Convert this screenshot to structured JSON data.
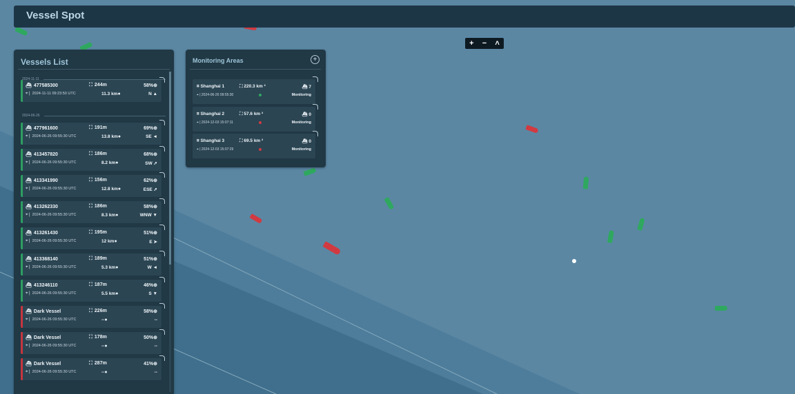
{
  "app": {
    "title": "Vessel Spot"
  },
  "zoom_controls": {
    "zoom_in": "+",
    "zoom_out": "−",
    "compass": "˄"
  },
  "colors": {
    "ok_status": "#2e9e62",
    "dark_status": "#c6363f",
    "panel_bg": "#213845",
    "sea": "#5b87a3"
  },
  "vessels_panel": {
    "title": "Vessels List",
    "date_groups": [
      "2024-11-11",
      "2024-06-26"
    ],
    "items": [
      {
        "id": "477585300",
        "length": "244m",
        "confidence": "58%",
        "time": "2024-11-11 09:23:50 UTC",
        "distance": "11.3 km",
        "direction": "N ▲",
        "status": "ok"
      },
      {
        "id": "477961600",
        "length": "191m",
        "confidence": "69%",
        "time": "2024-06-26 09:55:30 UTC",
        "distance": "13.8 km",
        "direction": "SE ◄",
        "status": "ok"
      },
      {
        "id": "413457820",
        "length": "186m",
        "confidence": "68%",
        "time": "2024-06-26 09:55:30 UTC",
        "distance": "8.2 km",
        "direction": "SW ➚",
        "status": "ok"
      },
      {
        "id": "413341990",
        "length": "156m",
        "confidence": "62%",
        "time": "2024-06-26 09:55:30 UTC",
        "distance": "12.8 km",
        "direction": "ESE ➚",
        "status": "ok"
      },
      {
        "id": "413262330",
        "length": "186m",
        "confidence": "58%",
        "time": "2024-06-26 09:55:30 UTC",
        "distance": "8.3 km",
        "direction": "WNW ▼",
        "status": "ok"
      },
      {
        "id": "413261430",
        "length": "195m",
        "confidence": "51%",
        "time": "2024-06-26 09:55:30 UTC",
        "distance": "12 km",
        "direction": "E ➤",
        "status": "ok"
      },
      {
        "id": "413368140",
        "length": "189m",
        "confidence": "51%",
        "time": "2024-06-26 09:55:30 UTC",
        "distance": "5.3 km",
        "direction": "W ◄",
        "status": "ok"
      },
      {
        "id": "413246110",
        "length": "187m",
        "confidence": "46%",
        "time": "2024-06-26 09:55:30 UTC",
        "distance": "5.5 km",
        "direction": "S ▼",
        "status": "ok"
      },
      {
        "id": "Dark Vessel",
        "length": "226m",
        "confidence": "58%",
        "time": "2024-06-26 09:55:30 UTC",
        "distance": "--",
        "direction": "--",
        "status": "dark"
      },
      {
        "id": "Dark Vessel",
        "length": "178m",
        "confidence": "50%",
        "time": "2024-06-26 09:55:30 UTC",
        "distance": "--",
        "direction": "--",
        "status": "dark"
      },
      {
        "id": "Dark Vessel",
        "length": "287m",
        "confidence": "41%",
        "time": "2024-06-26 09:55:30 UTC",
        "distance": "--",
        "direction": "--",
        "status": "dark"
      }
    ]
  },
  "areas_panel": {
    "title": "Monitoring Areas",
    "add_label": "+",
    "items": [
      {
        "name": "Shanghai 1",
        "area": "220.3 km ²",
        "vessels": "7",
        "time": "2024-06-26 09:55:30",
        "status": "Monitoring",
        "dot_color": "#2fa85f"
      },
      {
        "name": "Shanghai 2",
        "area": "57.6 km ²",
        "vessels": "0",
        "time": "2024-12-03 15:07:11",
        "status": "Monitoring",
        "dot_color": "#d23a41"
      },
      {
        "name": "Shanghai 3",
        "area": "69.5 km ²",
        "vessels": "0",
        "time": "2024-12-03 15:07:29",
        "status": "Monitoring",
        "dot_color": "#d23a41"
      }
    ]
  }
}
